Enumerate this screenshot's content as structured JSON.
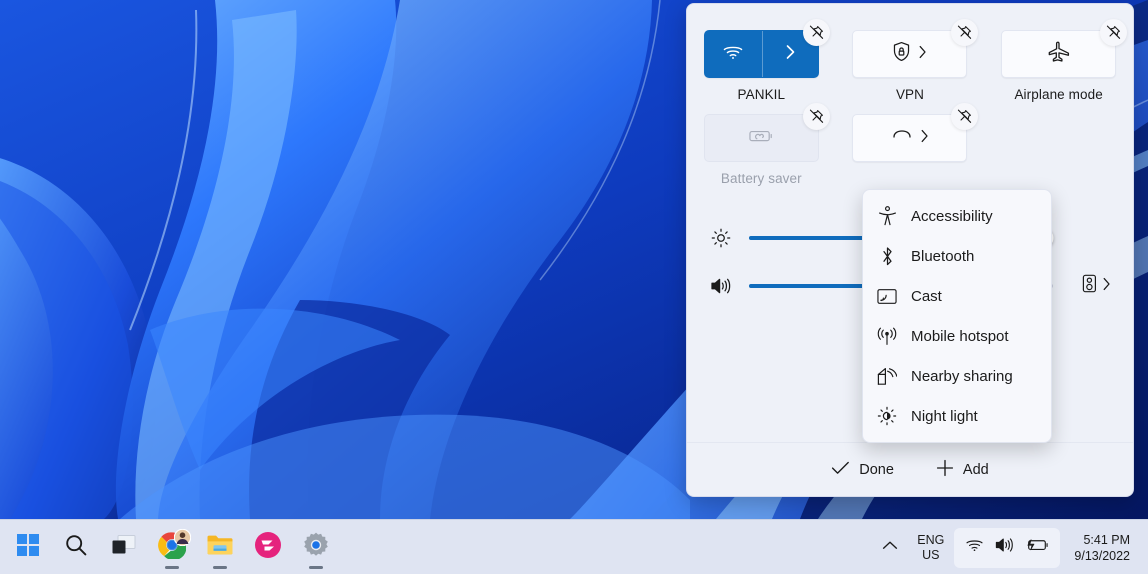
{
  "desktop": {
    "wallpaper_name": "windows-11-bloom-blue",
    "wallpaper_colors": [
      "#0a2ba6",
      "#1858e8",
      "#2f7bff",
      "#061c7a"
    ]
  },
  "quick_settings": {
    "accent_color": "#0f6cbd",
    "panel_bg": "#eef1f8",
    "tiles": [
      {
        "id": "wifi",
        "label": "PANKIL",
        "icon": "wifi-icon",
        "state": "on",
        "has_chevron": true,
        "pin": "unpin-icon"
      },
      {
        "id": "vpn",
        "label": "VPN",
        "icon": "shield-lock-icon",
        "state": "off",
        "has_chevron": true,
        "pin": "unpin-icon"
      },
      {
        "id": "airplane",
        "label": "Airplane mode",
        "icon": "airplane-icon",
        "state": "off",
        "has_chevron": false,
        "pin": "unpin-icon"
      },
      {
        "id": "battery-saver",
        "label": "Battery saver",
        "icon": "battery-saver-icon",
        "state": "disabled",
        "has_chevron": false,
        "pin": "unpin-icon"
      },
      {
        "id": "hidden-tile",
        "label": "",
        "icon": "partial-icon",
        "state": "off",
        "has_chevron": true,
        "pin": "unpin-icon"
      }
    ],
    "sliders": [
      {
        "id": "brightness",
        "icon": "brightness-icon",
        "value": 97,
        "tail_icon": "",
        "tail_chevron": false
      },
      {
        "id": "volume",
        "icon": "volume-icon",
        "value": 72,
        "tail_icon": "audio-output-icon",
        "tail_chevron": true
      }
    ],
    "footer": {
      "done_label": "Done",
      "done_icon": "check-icon",
      "add_label": "Add",
      "add_icon": "plus-icon"
    }
  },
  "flyout_menu": {
    "items": [
      {
        "label": "Accessibility",
        "icon": "accessibility-icon"
      },
      {
        "label": "Bluetooth",
        "icon": "bluetooth-icon"
      },
      {
        "label": "Cast",
        "icon": "cast-icon"
      },
      {
        "label": "Mobile hotspot",
        "icon": "mobile-hotspot-icon"
      },
      {
        "label": "Nearby sharing",
        "icon": "nearby-sharing-icon"
      },
      {
        "label": "Night light",
        "icon": "night-light-icon"
      }
    ]
  },
  "taskbar": {
    "bg_color": "#dfe4f2",
    "apps": [
      {
        "id": "start",
        "icon": "windows-start-icon",
        "running": false
      },
      {
        "id": "search",
        "icon": "search-icon",
        "running": false
      },
      {
        "id": "task-view",
        "icon": "task-view-icon",
        "running": false
      },
      {
        "id": "chrome",
        "icon": "chrome-icon",
        "running": true
      },
      {
        "id": "file-explorer",
        "icon": "folder-icon",
        "running": true
      },
      {
        "id": "app-pink",
        "icon": "pink-app-icon",
        "running": false
      },
      {
        "id": "settings",
        "icon": "settings-gear-icon",
        "running": true
      }
    ],
    "tray": {
      "chevron_icon": "chevron-up-icon",
      "language_line1": "ENG",
      "language_line2": "US",
      "icons": [
        "wifi-icon",
        "volume-icon",
        "battery-charging-icon"
      ],
      "time": "5:41 PM",
      "date": "9/13/2022"
    }
  }
}
